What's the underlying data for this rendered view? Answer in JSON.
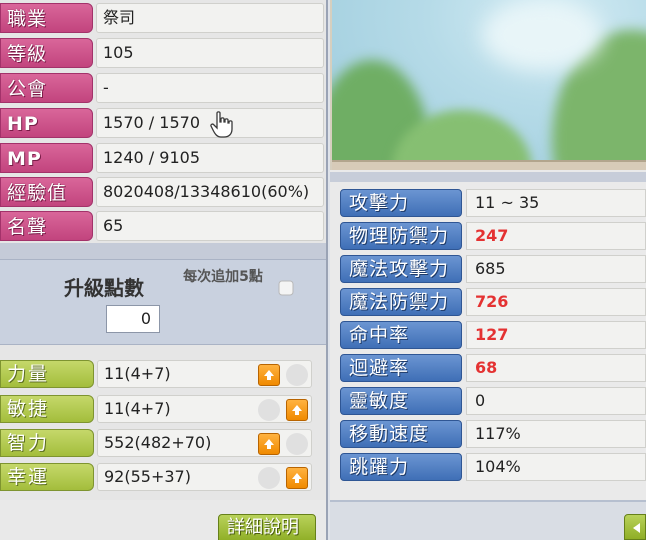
{
  "character": {
    "rows": [
      {
        "label": "職業",
        "value": "祭司"
      },
      {
        "label": "等級",
        "value": "105"
      },
      {
        "label": "公會",
        "value": "-"
      },
      {
        "label": "HP",
        "value": "1570 / 1570"
      },
      {
        "label": "MP",
        "value": "1240 / 9105"
      },
      {
        "label": "經驗值",
        "value": "8020408/13348610(60%)"
      },
      {
        "label": "名聲",
        "value": "65"
      }
    ]
  },
  "ability_points": {
    "title": "升級點數",
    "value": "0",
    "auto_add_label": "每次追加5點",
    "auto_add_checked": false
  },
  "stats": [
    {
      "label": "力量",
      "value": "11(4+7)",
      "up_enabled": true
    },
    {
      "label": "敏捷",
      "value": "11(4+7)",
      "up_enabled": true
    },
    {
      "label": "智力",
      "value": "552(482+70)",
      "up_enabled": true
    },
    {
      "label": "幸運",
      "value": "92(55+37)",
      "up_enabled": true
    }
  ],
  "detail_button": "詳細說明",
  "combat_stats": [
    {
      "label": "攻擊力",
      "value": "11 ~ 35",
      "highlight": false
    },
    {
      "label": "物理防禦力",
      "value": "247",
      "highlight": true
    },
    {
      "label": "魔法攻擊力",
      "value": "685",
      "highlight": false
    },
    {
      "label": "魔法防禦力",
      "value": "726",
      "highlight": true
    },
    {
      "label": "命中率",
      "value": "127",
      "highlight": true
    },
    {
      "label": "迴避率",
      "value": "68",
      "highlight": true
    },
    {
      "label": "靈敏度",
      "value": "0",
      "highlight": false
    },
    {
      "label": "移動速度",
      "value": "117%",
      "highlight": false
    },
    {
      "label": "跳躍力",
      "value": "104%",
      "highlight": false
    }
  ],
  "colors": {
    "info_label": "#c2447e",
    "stat_label": "#a3bd3c",
    "combat_label": "#3f6fb6",
    "highlight_value": "#e43232",
    "up_button": "#f08a00"
  }
}
